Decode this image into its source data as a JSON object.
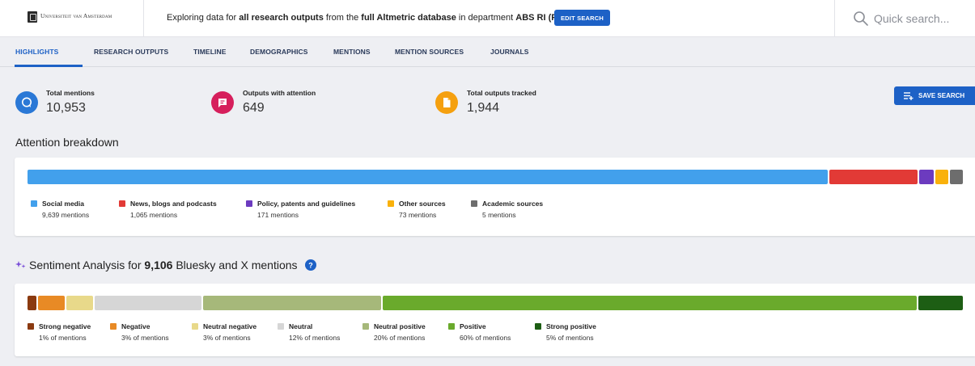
{
  "header": {
    "logo_text": "Universiteit van Amsterdam",
    "explore": {
      "prefix": "Exploring data for ",
      "outputs": "all research outputs",
      "from": " from the ",
      "database": "full Altmetric database",
      "in": " in department ",
      "department": "ABS RI (FEB)"
    },
    "edit_button": "EDIT SEARCH",
    "search_placeholder": "Quick search..."
  },
  "tabs": [
    {
      "label": "HIGHLIGHTS",
      "active": true
    },
    {
      "label": "RESEARCH OUTPUTS"
    },
    {
      "label": "TIMELINE"
    },
    {
      "label": "DEMOGRAPHICS"
    },
    {
      "label": "MENTIONS"
    },
    {
      "label": "MENTION SOURCES"
    },
    {
      "label": "JOURNALS"
    }
  ],
  "stats": [
    {
      "label": "Total mentions",
      "value": "10,953",
      "icon": "chat-bubbles-icon",
      "color": "#2a78d6"
    },
    {
      "label": "Outputs with attention",
      "value": "649",
      "icon": "message-icon",
      "color": "#d61f5c"
    },
    {
      "label": "Total outputs tracked",
      "value": "1,944",
      "icon": "document-icon",
      "color": "#f5a00f"
    }
  ],
  "save_button": "SAVE SEARCH",
  "attention": {
    "title": "Attention breakdown",
    "items": [
      {
        "name": "Social media",
        "sub": "9,639 mentions",
        "mentions": 9639,
        "color": "#42a0ec"
      },
      {
        "name": "News, blogs and podcasts",
        "sub": "1,065 mentions",
        "mentions": 1065,
        "color": "#e23a36"
      },
      {
        "name": "Policy, patents and guidelines",
        "sub": "171 mentions",
        "mentions": 171,
        "color": "#6c3bbf"
      },
      {
        "name": "Other sources",
        "sub": "73 mentions",
        "mentions": 73,
        "color": "#f9b10b"
      },
      {
        "name": "Academic sources",
        "sub": "5 mentions",
        "mentions": 5,
        "color": "#6d6d6d"
      }
    ]
  },
  "sentiment": {
    "title_prefix": "Sentiment Analysis for ",
    "title_count": "9,106",
    "title_suffix": " Bluesky and X mentions",
    "items": [
      {
        "name": "Strong negative",
        "sub": "1% of mentions",
        "percent": 1,
        "color": "#8b3a10"
      },
      {
        "name": "Negative",
        "sub": "3% of mentions",
        "percent": 3,
        "color": "#e88a25"
      },
      {
        "name": "Neutral negative",
        "sub": "3% of mentions",
        "percent": 3,
        "color": "#e8d98a"
      },
      {
        "name": "Neutral",
        "sub": "12% of mentions",
        "percent": 12,
        "color": "#d6d6d6"
      },
      {
        "name": "Neutral positive",
        "sub": "20% of mentions",
        "percent": 20,
        "color": "#a6b87a"
      },
      {
        "name": "Positive",
        "sub": "60% of mentions",
        "percent": 60,
        "color": "#6aaa2c"
      },
      {
        "name": "Strong positive",
        "sub": "5% of mentions",
        "percent": 5,
        "color": "#1d5e14"
      }
    ]
  }
}
